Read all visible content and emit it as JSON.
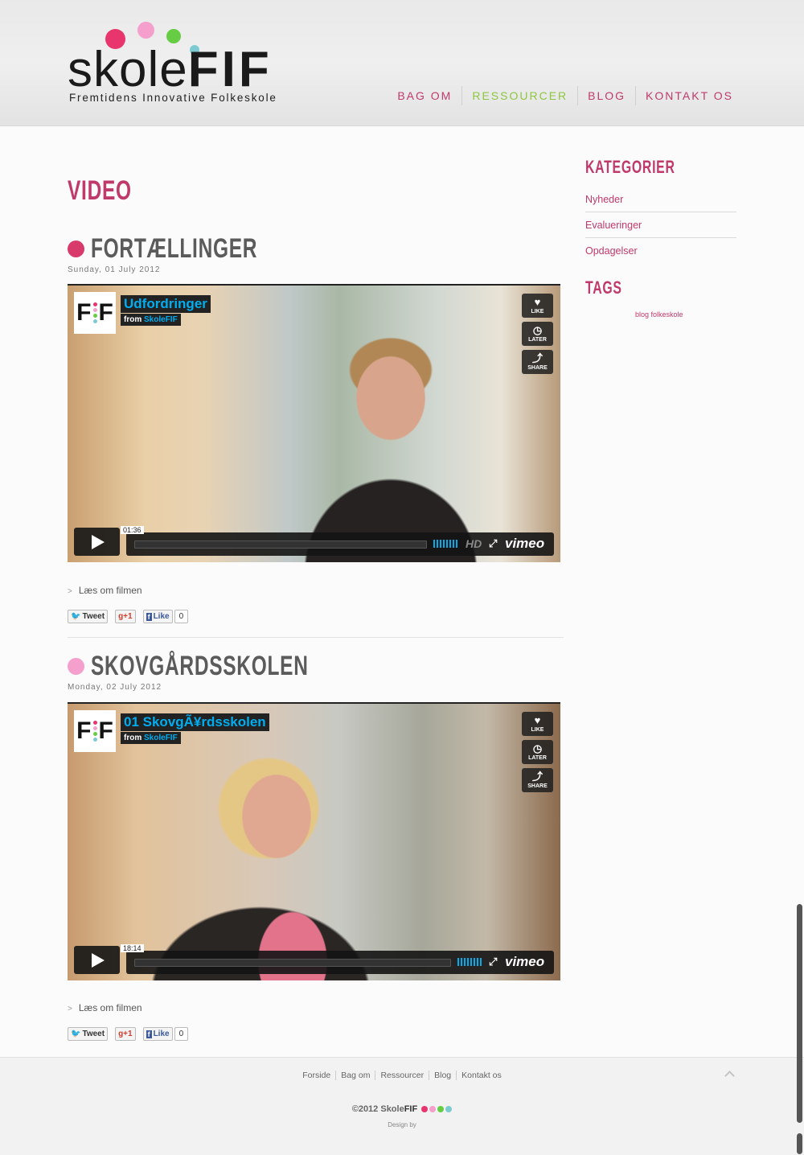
{
  "brand": {
    "logo_light": "skole",
    "logo_bold": "FIF",
    "tagline": "Fremtidens Innovative Folkeskole",
    "dot_colors": [
      "#e8356d",
      "#f59fcd",
      "#66cc44",
      "#7ccbd3"
    ]
  },
  "nav": {
    "items": [
      {
        "label": "BAG OM"
      },
      {
        "label": "RESSOURCER",
        "active": true
      },
      {
        "label": "BLOG"
      },
      {
        "label": "KONTAKT OS"
      }
    ]
  },
  "page": {
    "title": "VIDEO"
  },
  "articles": [
    {
      "title": "FORTÆLLINGER",
      "bullet_color": "#d93a6c",
      "date": "Sunday, 01 July 2012",
      "video": {
        "badge": "F F",
        "title": "Udfordringer",
        "from_prefix": "from",
        "from_channel": "SkoleFIF",
        "time": "01:36",
        "hd": "HD",
        "provider": "vimeo",
        "buttons": [
          "LIKE",
          "LATER",
          "SHARE"
        ]
      },
      "read_more": "Læs om filmen",
      "social": {
        "tweet": "Tweet",
        "gplus": "+1",
        "like": "Like",
        "like_count": "0"
      }
    },
    {
      "title": "SKOVGÅRDSSKOLEN",
      "bullet_color": "#f59fcd",
      "date": "Monday, 02 July 2012",
      "video": {
        "badge": "F F",
        "title": "01 SkovgÃ¥rdsskolen",
        "from_prefix": "from",
        "from_channel": "SkoleFIF",
        "time": "18:14",
        "provider": "vimeo",
        "buttons": [
          "LIKE",
          "LATER",
          "SHARE"
        ]
      },
      "read_more": "Læs om filmen",
      "social": {
        "tweet": "Tweet",
        "gplus": "+1",
        "like": "Like",
        "like_count": "0"
      }
    }
  ],
  "sidebar": {
    "categories_title": "KATEGORIER",
    "categories": [
      "Nyheder",
      "Evalueringer",
      "Opdagelser"
    ],
    "tags_title": "TAGS",
    "tags": "blog folkeskole"
  },
  "footer": {
    "nav": [
      "Forside",
      "Bag om",
      "Ressourcer",
      "Blog",
      "Kontakt os"
    ],
    "copyright_prefix": "©2012 Skole",
    "copyright_brand": "FIF",
    "design_by": "Design by"
  }
}
